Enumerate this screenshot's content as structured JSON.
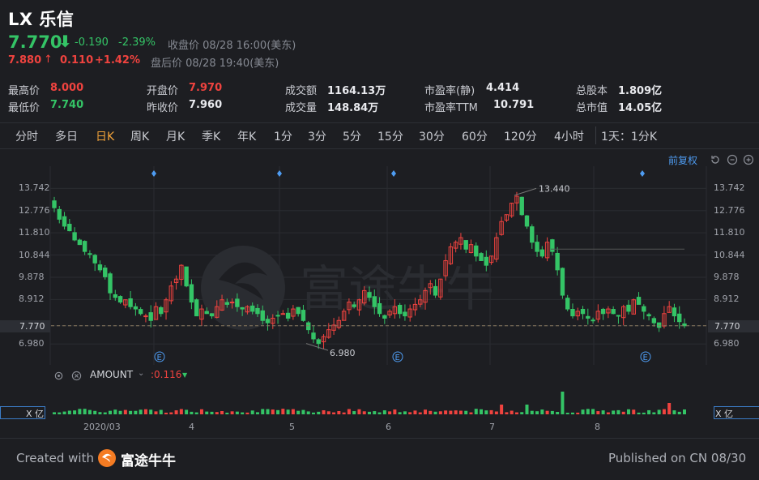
{
  "header": {
    "title": "LX 乐信",
    "price": "7.770",
    "change": "-0.190",
    "change_pct": "-2.39%",
    "close_label": "收盘价 08/28 16:00(美东)",
    "ah_price": "7.880",
    "ah_change": "0.110",
    "ah_change_pct": "+1.42%",
    "ah_label": "盘后价 08/28 19:40(美东)"
  },
  "stats": {
    "high_label": "最高价",
    "high": "8.000",
    "low_label": "最低价",
    "low": "7.740",
    "open_label": "开盘价",
    "open": "7.970",
    "prev_label": "昨收价",
    "prev": "7.960",
    "amount_label": "成交额",
    "amount": "1164.13万",
    "volume_label": "成交量",
    "volume": "148.84万",
    "pe_static_label": "市盈率(静)",
    "pe_static": "4.414",
    "pe_ttm_label": "市盈率TTM",
    "pe_ttm": "10.791",
    "shares_label": "总股本",
    "shares": "1.809亿",
    "mktcap_label": "总市值",
    "mktcap": "14.05亿"
  },
  "tabs": [
    "分时",
    "多日",
    "日K",
    "周K",
    "月K",
    "季K",
    "年K",
    "1分",
    "3分",
    "5分",
    "15分",
    "30分",
    "60分",
    "120分",
    "4小时",
    "1天：1分K"
  ],
  "active_tab": "日K",
  "chart_controls": {
    "adjust": "前复权"
  },
  "watermark": "富途牛牛",
  "indicator": {
    "name": "AMOUNT",
    "value": ":0.116"
  },
  "volume_axis_label": "X 亿",
  "colors": {
    "up": "#f0433f",
    "down": "#34c466",
    "bg": "#1d1e22",
    "accent": "#f2a33a"
  },
  "chart_data": {
    "type": "candlestick",
    "ylim": [
      6.6,
      14.0
    ],
    "y_ticks": [
      "13.742",
      "12.776",
      "11.810",
      "10.844",
      "9.878",
      "8.912",
      "7.770",
      "6.980"
    ],
    "right_ticks": [
      "13.742",
      "12.776",
      "11.810",
      "10.844",
      "9.878",
      "8.912",
      "7.770",
      "6.980"
    ],
    "x_ticks": [
      "2020/03",
      "4",
      "5",
      "6",
      "7",
      "8"
    ],
    "annotations": {
      "max_label": "13.440",
      "min_label": "6.980",
      "current": "7.770"
    },
    "close_series": [
      12.9,
      12.4,
      12.1,
      11.9,
      11.5,
      11.3,
      11.0,
      10.9,
      10.5,
      10.2,
      9.9,
      9.2,
      9.0,
      8.8,
      8.9,
      8.6,
      8.5,
      8.3,
      8.2,
      8.0,
      8.6,
      8.3,
      8.9,
      9.5,
      9.8,
      10.4,
      9.5,
      8.8,
      8.2,
      8.5,
      8.3,
      8.2,
      8.6,
      8.9,
      8.7,
      8.8,
      8.6,
      8.5,
      8.6,
      8.4,
      8.3,
      8.0,
      7.9,
      8.1,
      8.2,
      8.3,
      8.1,
      8.5,
      8.3,
      8.0,
      7.6,
      7.2,
      7.0,
      7.3,
      7.6,
      7.8,
      8.0,
      8.4,
      8.8,
      8.6,
      8.9,
      9.3,
      9.0,
      8.6,
      8.3,
      8.1,
      8.4,
      8.6,
      8.3,
      8.2,
      8.5,
      8.7,
      8.9,
      9.3,
      9.6,
      9.1,
      9.8,
      10.6,
      11.2,
      11.4,
      11.6,
      11.1,
      11.3,
      10.8,
      10.6,
      10.4,
      10.8,
      11.6,
      12.3,
      12.6,
      13.1,
      13.4,
      12.6,
      12.1,
      11.4,
      11.0,
      10.8,
      11.4,
      11.0,
      10.2,
      9.1,
      8.5,
      8.2,
      8.4,
      8.3,
      8.1,
      8.0,
      8.4,
      8.3,
      8.5,
      8.3,
      8.2,
      8.6,
      8.4,
      8.9,
      8.7,
      8.4,
      8.2,
      7.9,
      7.7,
      8.3,
      8.6,
      8.2,
      7.95,
      7.77
    ]
  }
}
